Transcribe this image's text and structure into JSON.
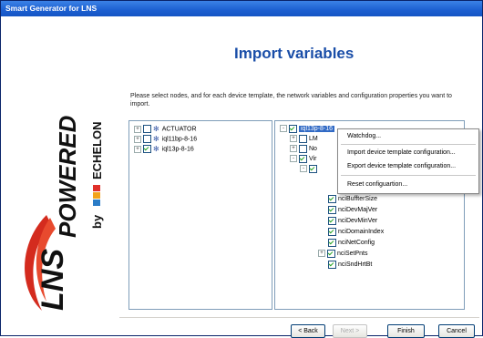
{
  "window": {
    "title": "Smart Generator for LNS"
  },
  "heading": "Import variables",
  "instructions": "Please select nodes, and for each device template, the network variables and configuration properties you want to import.",
  "logo": {
    "brand_text": "LNS POWERED",
    "by": "by",
    "partner": "ECHELON"
  },
  "left_tree": {
    "nodes": [
      {
        "label": "ACTUATOR",
        "checked": false,
        "expander": "+"
      },
      {
        "label": "iql11bp-8-16",
        "checked": false,
        "expander": "+"
      },
      {
        "label": "iql13p-8-16",
        "checked": true,
        "expander": "+"
      }
    ]
  },
  "right_tree": {
    "root": {
      "label": "iql13p-8-16",
      "checked": true,
      "expander": "-"
    },
    "partial": [
      {
        "label": "LM",
        "checked": false,
        "expander": "+"
      },
      {
        "label": "No",
        "checked": false,
        "expander": "+"
      },
      {
        "label": "Vir",
        "checked": true,
        "expander": "-"
      },
      {
        "label": "",
        "checked": true,
        "expander": "-"
      }
    ],
    "items": [
      {
        "label": "nciBuffterSize",
        "checked": true,
        "expander": ""
      },
      {
        "label": "nciDevMajVer",
        "checked": true,
        "expander": ""
      },
      {
        "label": "nciDevMinVer",
        "checked": true,
        "expander": ""
      },
      {
        "label": "nciDomainIndex",
        "checked": true,
        "expander": ""
      },
      {
        "label": "nciNetConfig",
        "checked": true,
        "expander": ""
      },
      {
        "label": "nciSetPnts",
        "checked": true,
        "expander": "+"
      },
      {
        "label": "nciSndHrtBt",
        "checked": true,
        "expander": ""
      }
    ]
  },
  "context_menu": {
    "items": [
      {
        "label": "Watchdog..."
      },
      {
        "label": "Import device template configuration..."
      },
      {
        "label": "Export device template configuration..."
      },
      {
        "label": "Reset configuartion..."
      }
    ]
  },
  "buttons": {
    "back": "< Back",
    "next": "Next >",
    "finish": "Finish",
    "cancel": "Cancel"
  },
  "colors": {
    "title_bar": "#1c5fd1",
    "heading": "#1a4ea8",
    "lns_red": "#d42b1e",
    "checkmark": "#21a121"
  }
}
